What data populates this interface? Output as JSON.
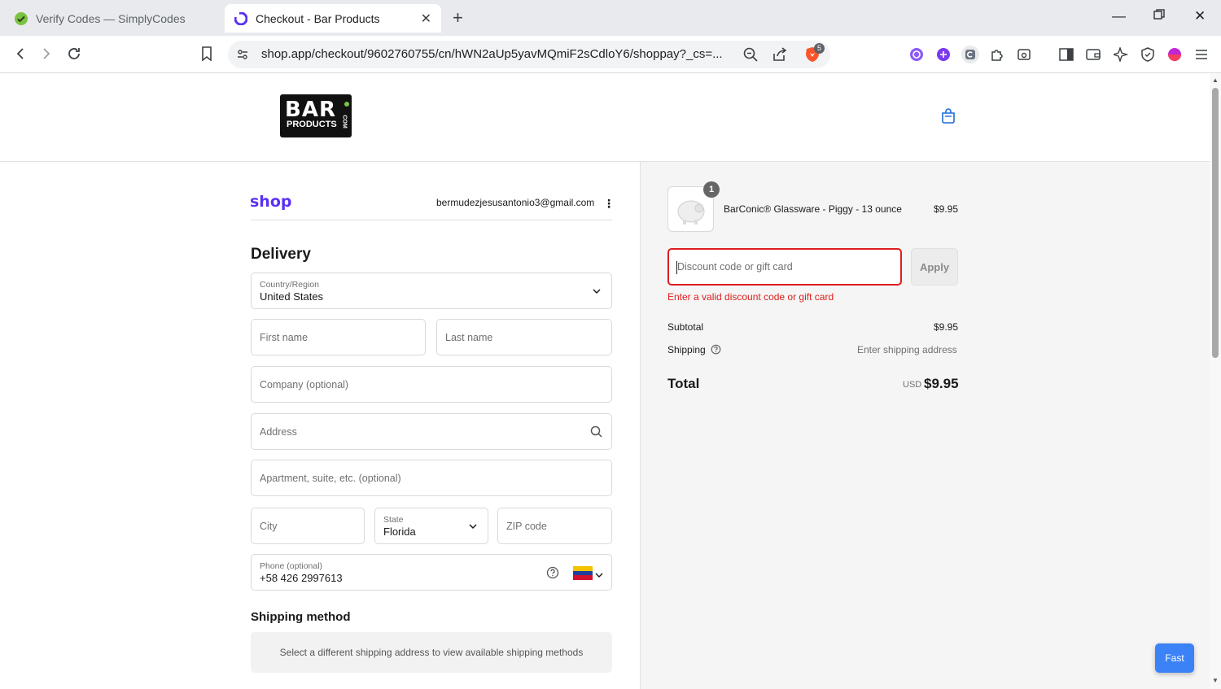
{
  "browser": {
    "tabs": [
      {
        "title": "Verify Codes — SimplyCodes",
        "active": false
      },
      {
        "title": "Checkout - Bar Products",
        "active": true
      }
    ],
    "url": "shop.app/checkout/9602760755/cn/hWN2aUp5yavMQmiF2sCdloY6/shoppay?_cs=...",
    "shield_badge": "5"
  },
  "header": {
    "logo_line1": "BAR",
    "logo_line2": "PRODUCTS",
    "logo_side": "COM"
  },
  "account": {
    "brand": "shop",
    "email": "bermudezjesusantonio3@gmail.com",
    "menu_icon": "more-vertical-icon"
  },
  "delivery": {
    "title": "Delivery",
    "country_label": "Country/Region",
    "country_value": "United States",
    "first_name_ph": "First name",
    "last_name_ph": "Last name",
    "company_ph": "Company (optional)",
    "address_ph": "Address",
    "apartment_ph": "Apartment, suite, etc. (optional)",
    "city_ph": "City",
    "state_label": "State",
    "state_value": "Florida",
    "zip_ph": "ZIP code",
    "phone_label": "Phone (optional)",
    "phone_value": "+58 426 2997613"
  },
  "shipping_method": {
    "title": "Shipping method",
    "notice": "Select a different shipping address to view available shipping methods"
  },
  "summary": {
    "item_name": "BarConic® Glassware - Piggy - 13 ounce",
    "item_qty": "1",
    "item_price": "$9.95",
    "discount_ph": "Discount code or gift card",
    "apply_label": "Apply",
    "discount_error": "Enter a valid discount code or gift card",
    "subtotal_label": "Subtotal",
    "subtotal_value": "$9.95",
    "shipping_label": "Shipping",
    "shipping_value": "Enter shipping address",
    "total_label": "Total",
    "currency": "USD",
    "total_value": "$9.95"
  },
  "fast_button": "Fast",
  "colors": {
    "shop_brand": "#5a31f4",
    "error": "#dd1d1d",
    "fast_button": "#3b82f6"
  }
}
